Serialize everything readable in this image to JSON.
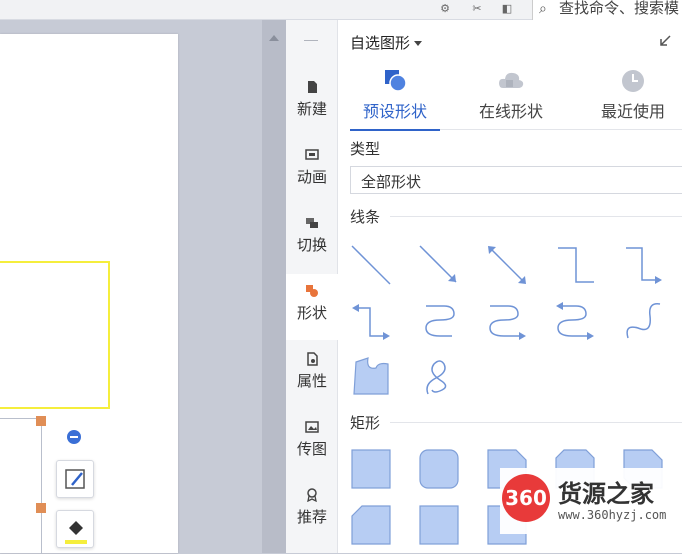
{
  "topbar": {
    "search_text": "查找命令、搜索模"
  },
  "nav": {
    "items": [
      {
        "label": "新建",
        "icon": "new-file-icon"
      },
      {
        "label": "动画",
        "icon": "animation-icon"
      },
      {
        "label": "切换",
        "icon": "transition-icon"
      },
      {
        "label": "形状",
        "icon": "shapes-icon",
        "active": true
      },
      {
        "label": "属性",
        "icon": "properties-icon"
      },
      {
        "label": "传图",
        "icon": "upload-image-icon"
      },
      {
        "label": "推荐",
        "icon": "recommend-icon"
      }
    ]
  },
  "panel": {
    "title": "自选图形",
    "tabs": [
      {
        "label": "预设形状",
        "active": true
      },
      {
        "label": "在线形状"
      },
      {
        "label": "最近使用"
      }
    ],
    "type_label": "类型",
    "type_value": "全部形状",
    "sections": {
      "lines": "线条",
      "rectangles": "矩形"
    }
  },
  "watermark": {
    "logo": "360",
    "name": "货源之家",
    "url": "www.360hyzj.com"
  },
  "colors": {
    "accent": "#2f63c9",
    "shape_fill": "#b7cdf3",
    "shape_stroke": "#7f9fd8",
    "highlight": "#f5ee3c",
    "handle": "#e08e56",
    "shapes_icon": "#e8743b"
  }
}
